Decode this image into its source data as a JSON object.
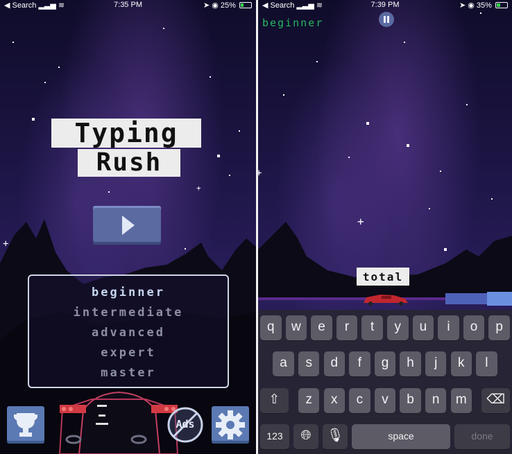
{
  "left_screen": {
    "status_bar": {
      "back_label": "◀ Search",
      "time": "7:35 PM",
      "battery": "25%",
      "battery_level": 0.25
    },
    "title": {
      "line1": "Typing",
      "line2": "Rush"
    },
    "difficulty_options": [
      {
        "label": "beginner",
        "selected": true
      },
      {
        "label": "intermediate",
        "selected": false
      },
      {
        "label": "advanced",
        "selected": false
      },
      {
        "label": "expert",
        "selected": false
      },
      {
        "label": "master",
        "selected": false
      }
    ],
    "ads_label": "Ads",
    "icons": {
      "trophy": "trophy-icon",
      "settings": "gear-icon",
      "play": "play-icon",
      "no_ads": "no-ads-icon"
    },
    "colors": {
      "selected": "#c6d4ee",
      "unselected": "#8e8fa6",
      "button": "#5b6aa1"
    }
  },
  "right_screen": {
    "status_bar": {
      "back_label": "◀ Search",
      "time": "7:39 PM",
      "battery": "35%",
      "battery_level": 0.35
    },
    "level": "beginner",
    "current_word": "total",
    "keyboard": {
      "row1": [
        "q",
        "w",
        "e",
        "r",
        "t",
        "y",
        "u",
        "i",
        "o",
        "p"
      ],
      "row2": [
        "a",
        "s",
        "d",
        "f",
        "g",
        "h",
        "j",
        "k",
        "l"
      ],
      "row3": [
        "z",
        "x",
        "c",
        "v",
        "b",
        "n",
        "m"
      ],
      "numbers_key": "123",
      "space_key": "space",
      "done_key": "done"
    },
    "icons": {
      "pause": "pause-icon",
      "shift": "shift-icon",
      "delete": "delete-icon",
      "globe": "globe-icon",
      "mic": "mic-icon"
    }
  }
}
